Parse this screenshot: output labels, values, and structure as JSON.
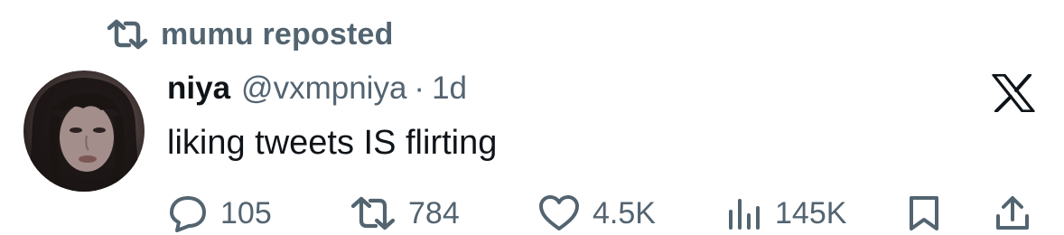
{
  "repost": {
    "icon": "repost-icon",
    "text": "mumu reposted"
  },
  "post": {
    "author": {
      "display_name": "niya",
      "handle": "@vxmpniya",
      "separator": "·",
      "time": "1d",
      "avatar": "avatar-photo"
    },
    "text": "liking tweets IS flirting",
    "platform_icon": "x-logo-icon"
  },
  "actions": {
    "reply": {
      "icon": "reply-icon",
      "count": "105"
    },
    "repost": {
      "icon": "repost-icon",
      "count": "784"
    },
    "like": {
      "icon": "heart-icon",
      "count": "4.5K"
    },
    "views": {
      "icon": "views-icon",
      "count": "145K"
    },
    "bookmark": {
      "icon": "bookmark-icon"
    },
    "share": {
      "icon": "share-icon"
    }
  },
  "colors": {
    "text_primary": "#0f1419",
    "text_secondary": "#536471",
    "background": "#ffffff"
  }
}
